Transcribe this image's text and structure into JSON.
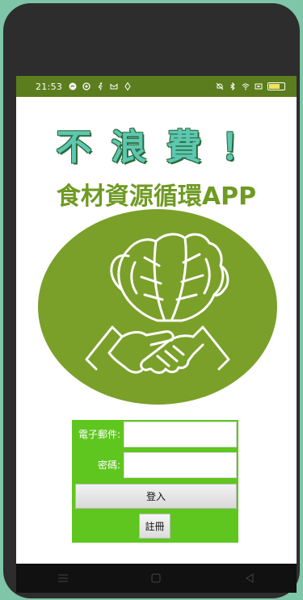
{
  "status_bar": {
    "time": "21:53",
    "left_icons": [
      "messenger-icon",
      "threads-icon",
      "runner-icon",
      "gmail-icon",
      "location-icon"
    ],
    "right_icons": [
      "mute-icon",
      "bluetooth-icon",
      "wifi-icon",
      "sim-icon",
      "battery-icon"
    ]
  },
  "header": {
    "title": "不浪費！",
    "subtitle": "食材資源循環APP"
  },
  "logo": {
    "icon": "vegetable-handshake-logo",
    "color": "#7aa02a"
  },
  "login_form": {
    "email_label": "電子郵件:",
    "email_value": "",
    "password_label": "密碼:",
    "password_value": "",
    "login_button": "登入",
    "register_button": "註冊"
  },
  "colors": {
    "status_bar": "#5c7d1e",
    "panel": "#5fc61f",
    "title": "#5ec7b2",
    "subtitle": "#6f9a23"
  },
  "nav_bar": {
    "buttons": [
      "menu-icon",
      "home-icon",
      "back-icon"
    ]
  }
}
